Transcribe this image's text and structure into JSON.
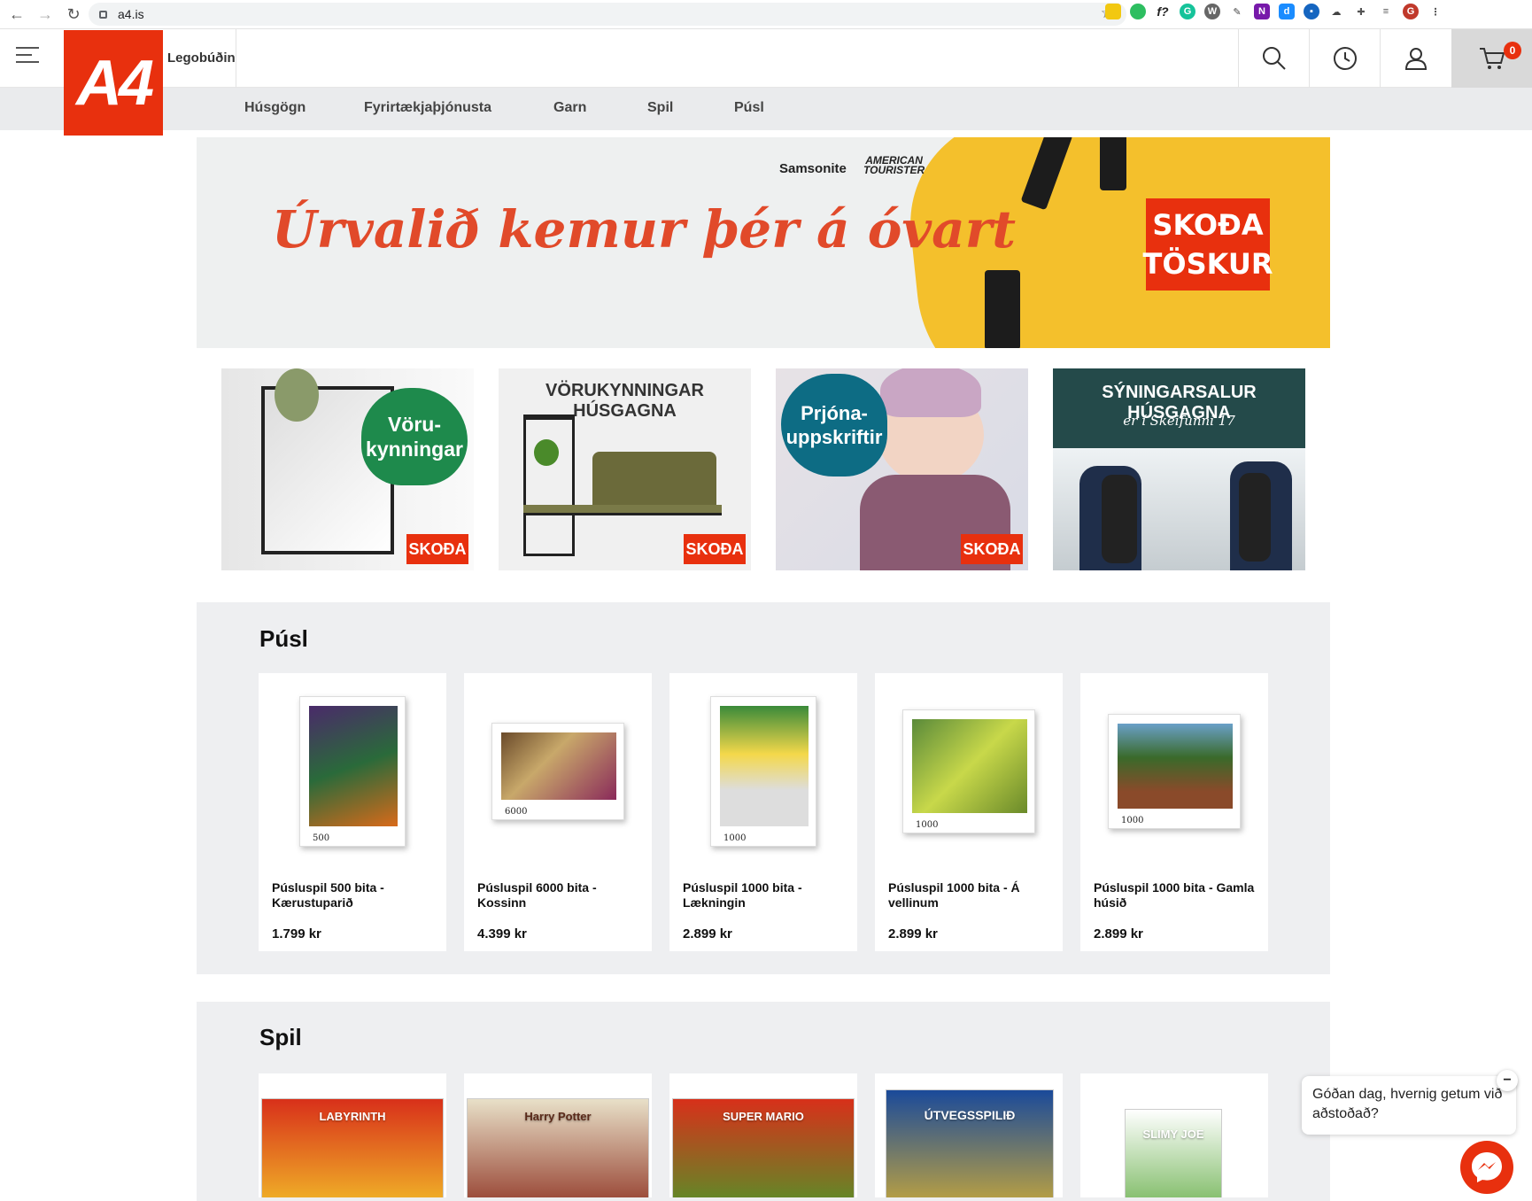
{
  "browser": {
    "url": "a4.is",
    "profile_initial": "G",
    "extensions": [
      "notes-icon",
      "evernote-icon",
      "formula-icon",
      "grammarly-icon",
      "wordpress-icon",
      "pen-icon",
      "onenote-icon",
      "d-icon",
      "b-icon",
      "cloud-icon",
      "puzzle-icon",
      "playlist-icon"
    ]
  },
  "header": {
    "logo_text": "A4",
    "store_name": "Legobúðin",
    "cart_count": "0"
  },
  "categories": [
    "Húsgögn",
    "Fyrirtækjaþjónusta",
    "Garn",
    "Spil",
    "Púsl"
  ],
  "hero": {
    "tagline": "Úrvalið kemur þér á óvart",
    "brand_1": "Samsonite",
    "brand_2_line1": "AMERICAN",
    "brand_2_line2": "TOURISTER",
    "cta_line1": "SKOÐA",
    "cta_line2": "TÖSKUR"
  },
  "tiles": [
    {
      "title": "Vöru-\nkynningar",
      "button": "SKOÐA"
    },
    {
      "title": "VÖRUKYNNINGAR HÚSGAGNA",
      "button": "SKOÐA"
    },
    {
      "title": "Prjóna-\nuppskriftir",
      "button": "SKOÐA"
    },
    {
      "title": "SÝNINGARSALUR HÚSGAGNA",
      "subtitle": "er í Skeifunni 17"
    }
  ],
  "pusl": {
    "title": "Púsl",
    "products": [
      {
        "name": "Púsluspil 500 bita - Kærustuparið",
        "price": "1.799 kr",
        "pieces": "500"
      },
      {
        "name": "Púsluspil 6000 bita - Kossinn",
        "price": "4.399 kr",
        "pieces": "6000"
      },
      {
        "name": "Púsluspil 1000 bita - Lækningin",
        "price": "2.899 kr",
        "pieces": "1000"
      },
      {
        "name": "Púsluspil 1000 bita - Á vellinum",
        "price": "2.899 kr",
        "pieces": "1000"
      },
      {
        "name": "Púsluspil 1000 bita - Gamla húsið",
        "price": "2.899 kr",
        "pieces": "1000"
      }
    ]
  },
  "spil": {
    "title": "Spil",
    "box_labels": [
      "LABYRINTH",
      "Harry Potter",
      "SUPER MARIO",
      "ÚTVEGSSPILIÐ",
      "SLIMY JOE"
    ]
  },
  "chat": {
    "greeting": "Góðan dag, hvernig getum við aðstoðað?",
    "minimize": "−"
  }
}
